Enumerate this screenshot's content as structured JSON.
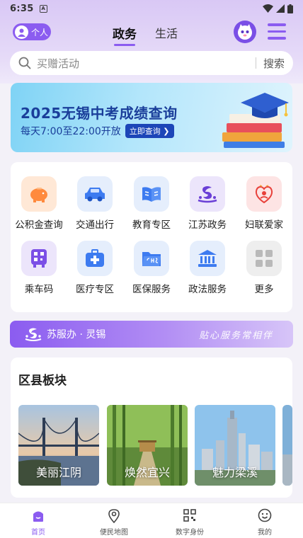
{
  "status_bar": {
    "time": "6:35",
    "notification_letter": "A"
  },
  "header": {
    "personal_label": "个人",
    "tabs": [
      {
        "label": "政务",
        "active": true
      },
      {
        "label": "生活",
        "active": false
      }
    ]
  },
  "search": {
    "placeholder": "买赠活动",
    "button": "搜索"
  },
  "banner": {
    "title": "2025无锡中考成绩查询",
    "subtitle": "每天7:00至22:00开放",
    "button": "立即查询"
  },
  "services": [
    {
      "label": "公积金查询",
      "icon": "piggy-bank-icon",
      "color": "#ff8a3d"
    },
    {
      "label": "交通出行",
      "icon": "car-icon",
      "color": "#3d7bf0"
    },
    {
      "label": "教育专区",
      "icon": "book-icon",
      "color": "#3d7bf0"
    },
    {
      "label": "江苏政务",
      "icon": "jiangsu-logo-icon",
      "color": "#6a3fd6"
    },
    {
      "label": "妇联爱家",
      "icon": "women-federation-icon",
      "color": "#e8403a"
    },
    {
      "label": "乘车码",
      "icon": "bus-qr-icon",
      "color": "#7b4fe6"
    },
    {
      "label": "医疗专区",
      "icon": "medical-kit-icon",
      "color": "#3d7bf0"
    },
    {
      "label": "医保服务",
      "icon": "chs-folder-icon",
      "color": "#3d7bf0"
    },
    {
      "label": "政法服务",
      "icon": "courthouse-icon",
      "color": "#3d7bf0"
    },
    {
      "label": "更多",
      "icon": "more-grid-icon",
      "color": "#b9b9b9"
    }
  ],
  "strip": {
    "brand": "苏服办 · 灵锡",
    "slogan": "贴心服务常相伴"
  },
  "districts": {
    "title": "区县板块",
    "cards": [
      {
        "label": "美丽江阴"
      },
      {
        "label": "焕然宜兴"
      },
      {
        "label": "魅力梁溪"
      }
    ]
  },
  "bottom_nav": [
    {
      "label": "首页",
      "icon": "home-icon",
      "active": true
    },
    {
      "label": "便民地图",
      "icon": "map-pin-icon",
      "active": false
    },
    {
      "label": "数字身份",
      "icon": "scan-icon",
      "active": false
    },
    {
      "label": "我的",
      "icon": "smiley-icon",
      "active": false
    }
  ],
  "colors": {
    "accent": "#8b5cf0",
    "banner_text": "#1a3e9a"
  }
}
